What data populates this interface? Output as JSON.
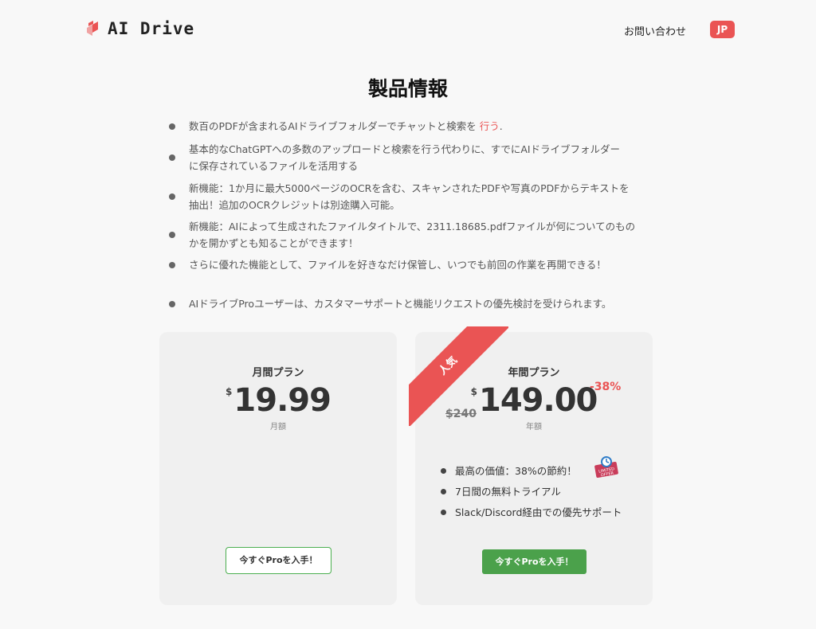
{
  "header": {
    "brand": "AI Drive",
    "contact_label": "お問い合わせ",
    "lang_label": "JP"
  },
  "page": {
    "title": "製品情報"
  },
  "features": [
    {
      "text": "数百のPDFが含まれるAIドライブフォルダーでチャットと検索を",
      "highlight": "行う",
      "suffix": "."
    },
    {
      "line1": "基本的なChatGPTへの多数のアップロードと検索を行う代わりに、すでにAIドライブフォルダー",
      "line2": "に保存されているファイルを活用する"
    },
    {
      "line1": "新機能：1か月に最大5000ページのOCRを含む、スキャンされたPDFや写真のPDFからテキストを",
      "line2": "抽出！追加のOCRクレジットは別途購入可能。"
    },
    {
      "line1": "新機能：AIによって生成されたファイルタイトルで、2311.18685.pdfファイルが何についてのもの",
      "line2": "かを開かずとも知ることができます！"
    },
    {
      "text": "さらに優れた機能として、ファイルを好きなだけ保管し、いつでも前回の作業を再開できる！"
    },
    {
      "text": "AIドライブProユーザーは、カスタマーサポートと機能リクエストの優先検討を受けられます。"
    }
  ],
  "plans": {
    "monthly": {
      "name": "月間プラン",
      "currency": "$",
      "price": "19.99",
      "period": "月額",
      "cta": "今すぐProを入手！"
    },
    "yearly": {
      "ribbon": "人気",
      "name": "年間プラン",
      "currency": "$",
      "price": "149.00",
      "old_price": "$240",
      "discount": "-38%",
      "period": "年額",
      "badge_icon": "limited-offer-icon",
      "badge_text": "LIMITED OFFER",
      "perks": [
        "最高の価値：38%の節約！",
        "7日間の無料トライアル",
        "Slack/Discord経由での優先サポート"
      ],
      "cta": "今すぐProを入手！"
    }
  },
  "colors": {
    "accent": "#ea5454",
    "green": "#4ba14b",
    "card_bg": "#f0f0f0",
    "page_bg": "#f8f8f8"
  }
}
